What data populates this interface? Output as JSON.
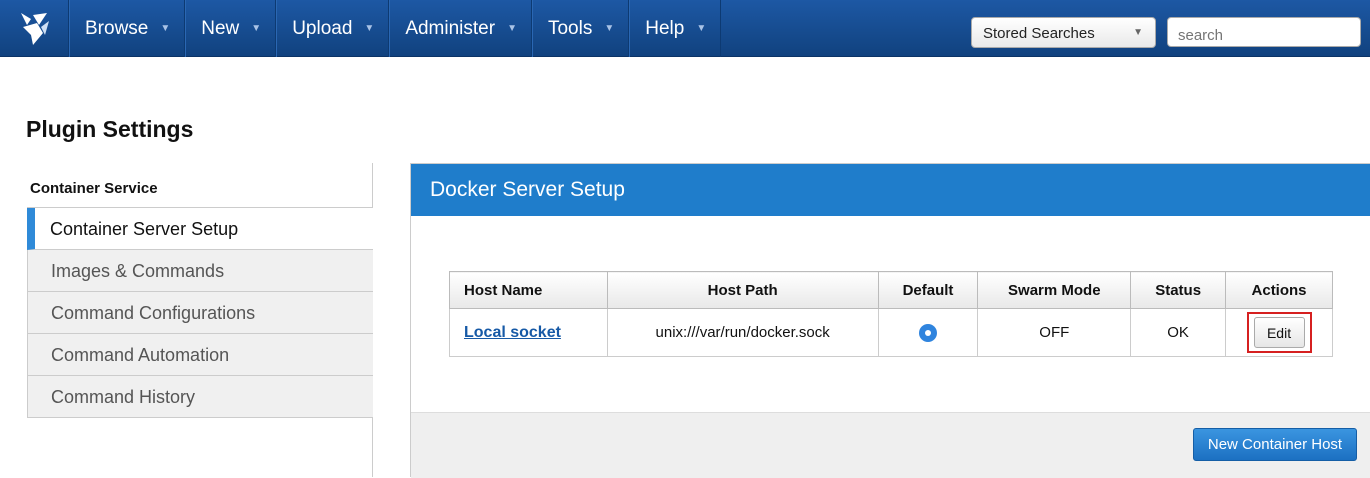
{
  "nav": {
    "items": [
      {
        "label": "Browse"
      },
      {
        "label": "New"
      },
      {
        "label": "Upload"
      },
      {
        "label": "Administer"
      },
      {
        "label": "Tools"
      },
      {
        "label": "Help"
      }
    ],
    "stored_searches": "Stored Searches",
    "search_placeholder": "search"
  },
  "page": {
    "title": "Plugin Settings"
  },
  "sidebar": {
    "heading": "Container Service",
    "items": [
      {
        "label": "Container Server Setup",
        "active": true
      },
      {
        "label": "Images & Commands"
      },
      {
        "label": "Command Configurations"
      },
      {
        "label": "Command Automation"
      },
      {
        "label": "Command History"
      }
    ]
  },
  "panel": {
    "title": "Docker Server Setup",
    "columns": [
      "Host Name",
      "Host Path",
      "Default",
      "Swarm Mode",
      "Status",
      "Actions"
    ],
    "rows": [
      {
        "host_name": "Local socket",
        "host_path": "unix:///var/run/docker.sock",
        "default": true,
        "swarm_mode": "OFF",
        "status": "OK",
        "action": "Edit"
      }
    ],
    "new_button": "New Container Host"
  },
  "colors": {
    "nav": "#1d58a4",
    "panel_header": "#1f7dcb",
    "accent": "#2f8ad8",
    "highlight": "#d62020"
  }
}
